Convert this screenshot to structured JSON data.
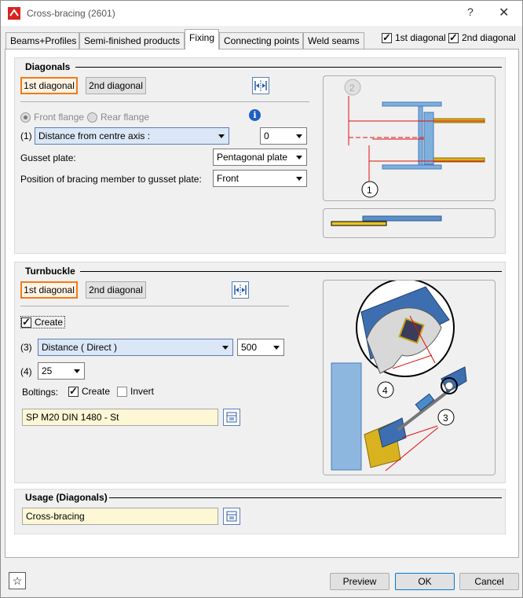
{
  "window": {
    "title": "Cross-bracing (2601)",
    "help": "?",
    "close": "✕"
  },
  "tabs": [
    "Beams+Profiles",
    "Semi-finished products",
    "Fixing",
    "Connecting points",
    "Weld seams"
  ],
  "active_tab": "Fixing",
  "top_checks": {
    "first": "1st diagonal",
    "second": "2nd diagonal",
    "first_checked": true,
    "second_checked": true
  },
  "diagonals": {
    "title": "Diagonals",
    "btn1": "1st diagonal",
    "btn2": "2nd diagonal",
    "front_flange": "Front flange",
    "rear_flange": "Rear flange",
    "param1_label": "(1)",
    "param1_value": "Distance from centre axis :",
    "param1_num": "0",
    "gusset_label": "Gusset plate:",
    "gusset_value": "Pentagonal plate",
    "position_label": "Position of bracing member to gusset plate:",
    "position_value": "Front",
    "diagram_callouts": [
      "2",
      "1"
    ]
  },
  "turnbuckle": {
    "title": "Turnbuckle",
    "btn1": "1st diagonal",
    "btn2": "2nd diagonal",
    "create_label": "Create",
    "create_checked": true,
    "param3_label": "(3)",
    "param3_value": "Distance ( Direct )",
    "param3_num": "500",
    "param4_label": "(4)",
    "param4_value": "25",
    "boltings_label": "Boltings:",
    "boltings_create": "Create",
    "boltings_create_checked": true,
    "boltings_invert": "Invert",
    "boltings_invert_checked": false,
    "bolt_value": "SP M20 DIN 1480 - St",
    "diagram_callouts": [
      "4",
      "3"
    ]
  },
  "usage": {
    "title": "Usage (Diagonals)",
    "value": "Cross-bracing"
  },
  "footer": {
    "preview": "Preview",
    "ok": "OK",
    "cancel": "Cancel",
    "favorites_icon": "star-icon"
  },
  "colors": {
    "accent_orange": "#f27a1a",
    "field_yellow": "#fdf7d6",
    "steel_blue": "#4a7ab8",
    "dim_red": "#e01010"
  }
}
